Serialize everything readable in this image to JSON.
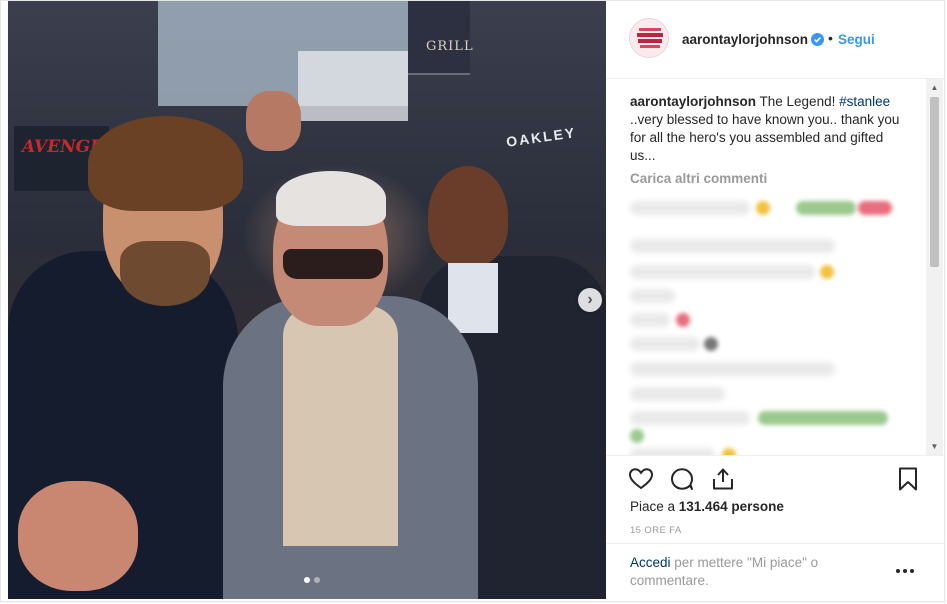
{
  "photo": {
    "banner_text": "AVENGERS",
    "sign_text": "GRILL",
    "store_text": "OAKLEY",
    "carousel": {
      "total": 2,
      "active": 1
    }
  },
  "header": {
    "username": "aarontaylorjohnson",
    "separator": "•",
    "follow_label": "Segui",
    "avatar_text": "THIS IS WHAT A KICKASS FEMINIST LOOKS LIKE"
  },
  "caption": {
    "username": "aarontaylorjohnson",
    "text_before": " The Legend! ",
    "hashtag": "#stanlee",
    "text_after": " ..very blessed to have known you.. thank you for all the hero's you assembled and gifted us..."
  },
  "comments": {
    "load_more": "Carica altri commenti"
  },
  "stats": {
    "likes_prefix": "Piace a ",
    "likes_count": "131.464",
    "likes_suffix": " persone",
    "time": "15 ORE FA"
  },
  "footer": {
    "login_link": "Accedi",
    "login_rest": " per mettere \"Mi piace\" o commentare."
  },
  "colors": {
    "link": "#3897f0",
    "hashtag": "#003569",
    "muted": "#999999",
    "text": "#262626"
  }
}
